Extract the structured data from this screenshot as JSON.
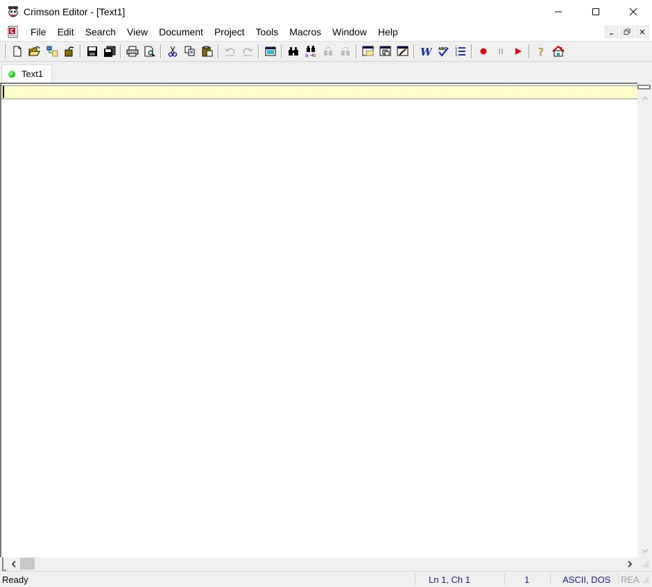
{
  "window": {
    "title": "Crimson Editor - [Text1]",
    "controls": {
      "minimize": "─",
      "maximize": "☐",
      "close": "✕"
    }
  },
  "menubar": {
    "items": [
      "File",
      "Edit",
      "Search",
      "View",
      "Document",
      "Project",
      "Tools",
      "Macros",
      "Window",
      "Help"
    ],
    "mdi_controls": {
      "minimize": "_",
      "restore": "🗗",
      "close": "✕"
    }
  },
  "toolbar": {
    "buttons": [
      {
        "icon": "new-file-icon",
        "tooltip": "New"
      },
      {
        "icon": "open-folder-icon",
        "tooltip": "Open"
      },
      {
        "icon": "open-remote-icon",
        "tooltip": "Open Remote"
      },
      {
        "icon": "reload-icon",
        "tooltip": "Reload"
      },
      {
        "icon": "save-icon",
        "tooltip": "Save"
      },
      {
        "icon": "save-all-icon",
        "tooltip": "Save All"
      },
      {
        "icon": "print-icon",
        "tooltip": "Print"
      },
      {
        "icon": "print-preview-icon",
        "tooltip": "Print Preview"
      },
      {
        "icon": "cut-icon",
        "tooltip": "Cut"
      },
      {
        "icon": "copy-icon",
        "tooltip": "Copy"
      },
      {
        "icon": "paste-icon",
        "tooltip": "Paste"
      },
      {
        "icon": "undo-icon",
        "tooltip": "Undo",
        "disabled": true
      },
      {
        "icon": "redo-icon",
        "tooltip": "Redo",
        "disabled": true
      },
      {
        "icon": "column-mode-icon",
        "tooltip": "Column Mode"
      },
      {
        "icon": "find-icon",
        "tooltip": "Find"
      },
      {
        "icon": "replace-icon",
        "tooltip": "Replace"
      },
      {
        "icon": "find-next-icon",
        "tooltip": "Find Next",
        "disabled": true
      },
      {
        "icon": "find-prev-icon",
        "tooltip": "Find Previous",
        "disabled": true
      },
      {
        "icon": "directory-window-icon",
        "tooltip": "Directory Window"
      },
      {
        "icon": "output-window-icon",
        "tooltip": "Output Window"
      },
      {
        "icon": "properties-icon",
        "tooltip": "Properties"
      },
      {
        "icon": "word-wrap-icon",
        "tooltip": "Word Wrap"
      },
      {
        "icon": "spell-check-icon",
        "tooltip": "Spell Check"
      },
      {
        "icon": "line-numbers-icon",
        "tooltip": "Line Numbers"
      },
      {
        "icon": "record-macro-icon",
        "tooltip": "Record"
      },
      {
        "icon": "pause-macro-icon",
        "tooltip": "Pause",
        "disabled": true
      },
      {
        "icon": "play-macro-icon",
        "tooltip": "Play"
      },
      {
        "icon": "help-icon",
        "tooltip": "Help"
      },
      {
        "icon": "home-icon",
        "tooltip": "Home Page"
      }
    ]
  },
  "tabs": [
    {
      "label": "Text1",
      "status_color": "#22cc22",
      "active": true
    }
  ],
  "editor": {
    "content": "",
    "current_line_color": "#fffccc"
  },
  "statusbar": {
    "message": "Ready",
    "position": "Ln 1, Ch 1",
    "column": "1",
    "encoding": "ASCII, DOS",
    "mode": "READ"
  }
}
